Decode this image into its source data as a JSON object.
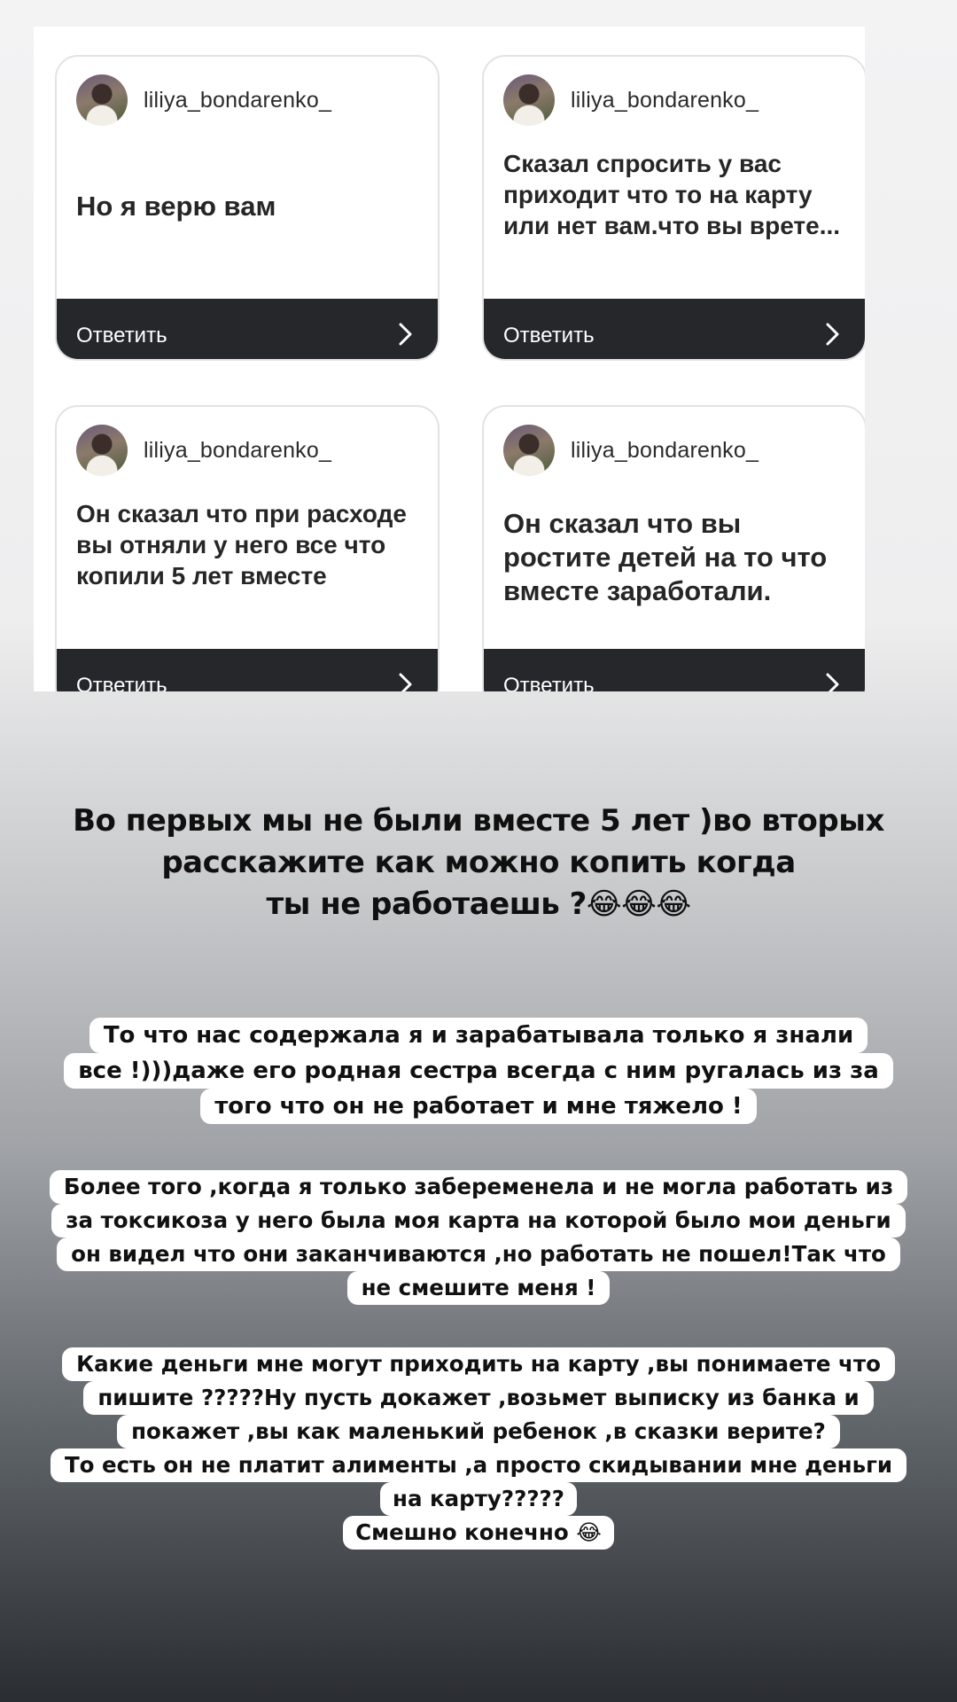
{
  "cards": [
    {
      "username": "liliya_bondarenko_",
      "text": "Но я верю вам",
      "reply": "Ответить"
    },
    {
      "username": "liliya_bondarenko_",
      "text": "Сказал спросить у вас приходит что то на карту или нет вам.что вы врете...",
      "reply": "Ответить"
    },
    {
      "username": "liliya_bondarenko_",
      "text": "Он сказал что при расходе вы отняли у него все что копили 5 лет вместе",
      "reply": "Ответить"
    },
    {
      "username": "liliya_bondarenko_",
      "text": "Он сказал что вы ростите детей на то что вместе заработали.",
      "reply": "Ответить"
    }
  ],
  "story": {
    "heading": [
      "Во первых мы не были вместе 5 лет )во вторых",
      "расскажите как можно копить когда",
      "ты не работаешь ?😂😂😂"
    ],
    "block1": [
      "То что нас содержала я и зарабатывала только я знали",
      "все !)))даже его родная сестра всегда с ним ругалась из за",
      "того что он не работает и мне тяжело !"
    ],
    "block2": [
      "Более того ,когда я только забеременела и не могла работать из",
      "за токсикоза  у него была моя карта на которой было мои деньги",
      "он видел что они заканчиваются ,но работать не пошел!Так что",
      "не смешите меня !"
    ],
    "block3": [
      "Какие деньги мне могут приходить на карту ,вы понимаете что",
      "пишите ?????Ну пусть докажет ,возьмет выписку из банка и",
      "покажет ,вы как маленький ребенок ,в сказки верите?",
      "То есть он не платит алименты ,а  просто скидывании мне деньги",
      "на карту?????",
      "Смешно конечно 😂"
    ]
  }
}
